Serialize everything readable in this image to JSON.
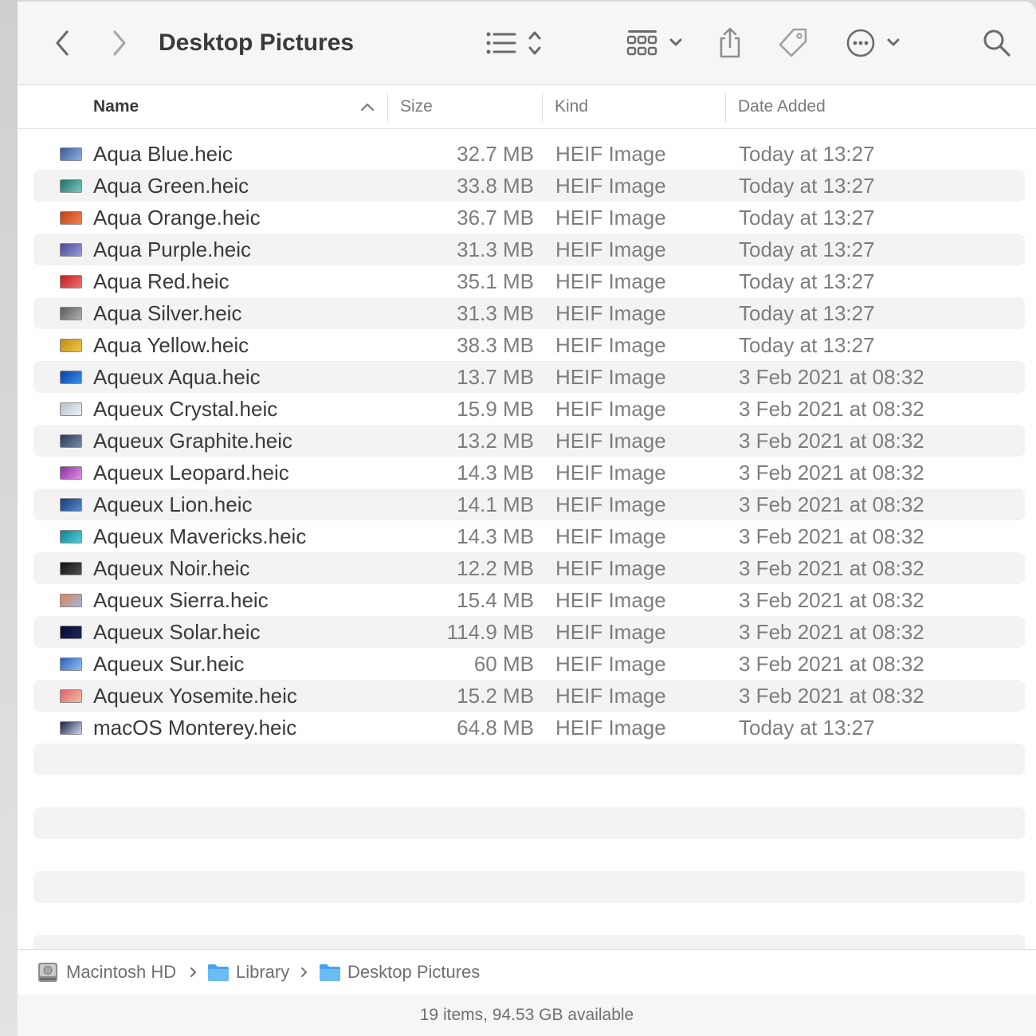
{
  "window": {
    "title": "Desktop Pictures"
  },
  "toolbar": {
    "back_icon": "chevron-left-icon",
    "forward_icon": "chevron-right-icon",
    "view_icon": "list-view-icon",
    "group_icon": "grid-group-icon",
    "share_icon": "share-icon",
    "tag_icon": "tag-icon",
    "more_icon": "ellipsis-circle-icon",
    "search_icon": "search-icon"
  },
  "columns": {
    "name": "Name",
    "size": "Size",
    "kind": "Kind",
    "date_added": "Date Added"
  },
  "files": [
    {
      "name": "Aqua Blue.heic",
      "size": "32.7 MB",
      "kind": "HEIF Image",
      "date": "Today at 13:27",
      "thumb": [
        "#3a5a9a",
        "#8fb0e0"
      ]
    },
    {
      "name": "Aqua Green.heic",
      "size": "33.8 MB",
      "kind": "HEIF Image",
      "date": "Today at 13:27",
      "thumb": [
        "#1f6e6a",
        "#7cc8c0"
      ]
    },
    {
      "name": "Aqua Orange.heic",
      "size": "36.7 MB",
      "kind": "HEIF Image",
      "date": "Today at 13:27",
      "thumb": [
        "#c2411a",
        "#f08050"
      ]
    },
    {
      "name": "Aqua Purple.heic",
      "size": "31.3 MB",
      "kind": "HEIF Image",
      "date": "Today at 13:27",
      "thumb": [
        "#4a4a9a",
        "#9a9ad8"
      ]
    },
    {
      "name": "Aqua Red.heic",
      "size": "35.1 MB",
      "kind": "HEIF Image",
      "date": "Today at 13:27",
      "thumb": [
        "#c02020",
        "#f07070"
      ]
    },
    {
      "name": "Aqua Silver.heic",
      "size": "31.3 MB",
      "kind": "HEIF Image",
      "date": "Today at 13:27",
      "thumb": [
        "#5a5a5a",
        "#b0b0b0"
      ]
    },
    {
      "name": "Aqua Yellow.heic",
      "size": "38.3 MB",
      "kind": "HEIF Image",
      "date": "Today at 13:27",
      "thumb": [
        "#c08a10",
        "#f0c850"
      ]
    },
    {
      "name": "Aqueux Aqua.heic",
      "size": "13.7 MB",
      "kind": "HEIF Image",
      "date": "3 Feb 2021 at 08:32",
      "thumb": [
        "#0a40a0",
        "#3a90f0"
      ]
    },
    {
      "name": "Aqueux Crystal.heic",
      "size": "15.9 MB",
      "kind": "HEIF Image",
      "date": "3 Feb 2021 at 08:32",
      "thumb": [
        "#b8c0c8",
        "#eef2f6"
      ]
    },
    {
      "name": "Aqueux Graphite.heic",
      "size": "13.2 MB",
      "kind": "HEIF Image",
      "date": "3 Feb 2021 at 08:32",
      "thumb": [
        "#2a3a5a",
        "#7a8aa8"
      ]
    },
    {
      "name": "Aqueux Leopard.heic",
      "size": "14.3 MB",
      "kind": "HEIF Image",
      "date": "3 Feb 2021 at 08:32",
      "thumb": [
        "#8a30a0",
        "#e090e8"
      ]
    },
    {
      "name": "Aqueux Lion.heic",
      "size": "14.1 MB",
      "kind": "HEIF Image",
      "date": "3 Feb 2021 at 08:32",
      "thumb": [
        "#1a3a7a",
        "#5a8ad0"
      ]
    },
    {
      "name": "Aqueux Mavericks.heic",
      "size": "14.3 MB",
      "kind": "HEIF Image",
      "date": "3 Feb 2021 at 08:32",
      "thumb": [
        "#108090",
        "#50d0d8"
      ]
    },
    {
      "name": "Aqueux Noir.heic",
      "size": "12.2 MB",
      "kind": "HEIF Image",
      "date": "3 Feb 2021 at 08:32",
      "thumb": [
        "#101010",
        "#505050"
      ]
    },
    {
      "name": "Aqueux Sierra.heic",
      "size": "15.4 MB",
      "kind": "HEIF Image",
      "date": "3 Feb 2021 at 08:32",
      "thumb": [
        "#e08050",
        "#a0b8e0"
      ]
    },
    {
      "name": "Aqueux Solar.heic",
      "size": "114.9 MB",
      "kind": "HEIF Image",
      "date": "3 Feb 2021 at 08:32",
      "thumb": [
        "#050a30",
        "#1a2a60"
      ]
    },
    {
      "name": "Aqueux Sur.heic",
      "size": "60 MB",
      "kind": "HEIF Image",
      "date": "3 Feb 2021 at 08:32",
      "thumb": [
        "#2a60c0",
        "#90c0f0"
      ]
    },
    {
      "name": "Aqueux Yosemite.heic",
      "size": "15.2 MB",
      "kind": "HEIF Image",
      "date": "3 Feb 2021 at 08:32",
      "thumb": [
        "#e06070",
        "#f0c0a0"
      ]
    },
    {
      "name": "macOS Monterey.heic",
      "size": "64.8 MB",
      "kind": "HEIF Image",
      "date": "Today at 13:27",
      "thumb": [
        "#1a2040",
        "#d0d8f0"
      ]
    }
  ],
  "pathbar": {
    "items": [
      {
        "label": "Macintosh HD",
        "icon": "hard-drive-icon"
      },
      {
        "label": "Library",
        "icon": "folder-icon"
      },
      {
        "label": "Desktop Pictures",
        "icon": "folder-icon"
      }
    ]
  },
  "status": {
    "text": "19 items, 94.53 GB available"
  },
  "colors": {
    "folder": "#5aaeea",
    "alt_row": "#f3f3f3",
    "icon": "#6b6b6b"
  }
}
